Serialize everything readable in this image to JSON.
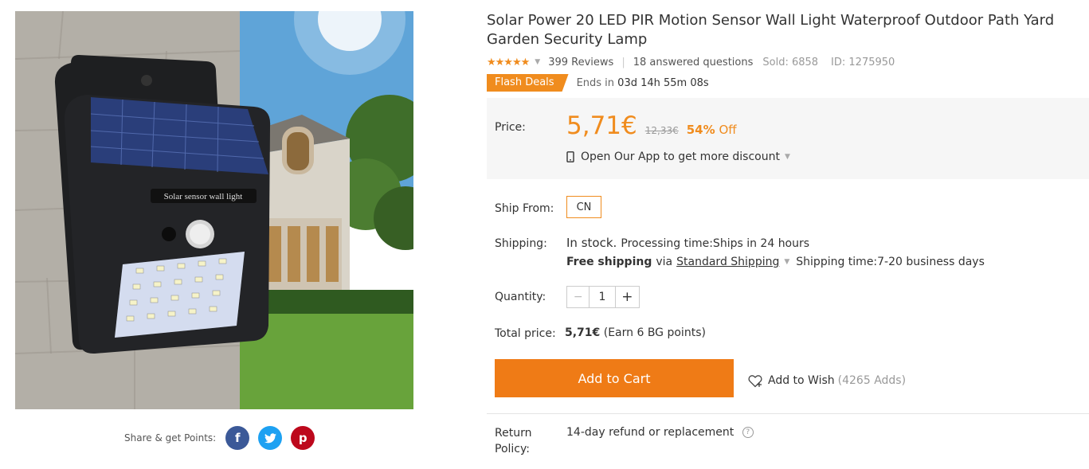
{
  "product": {
    "title": "Solar Power 20 LED PIR Motion Sensor Wall Light Waterproof Outdoor Path Yard Garden Security Lamp",
    "image_lamp_text": "Solar sensor wall light",
    "stars": "★★★★★",
    "rating": 5,
    "reviews": "399 Reviews",
    "answered": "18 answered questions",
    "sold": "Sold: 6858",
    "id": "ID: 1275950"
  },
  "flash": {
    "badge": "Flash Deals",
    "ends_label": "Ends in",
    "ends_time": "03d 14h 55m 08s"
  },
  "price": {
    "label": "Price:",
    "current": "5,71€",
    "old": "12,33€",
    "off_pct": "54%",
    "off_word": "Off",
    "app_text": "Open Our App to get more discount"
  },
  "ship": {
    "from_label": "Ship From:",
    "from_value": "CN",
    "shipping_label": "Shipping:",
    "stock": "In stock.",
    "processing": "Processing time:Ships in 24 hours",
    "free": "Free shipping",
    "via": "via",
    "method": "Standard Shipping",
    "time": "Shipping time:7-20 business days"
  },
  "quantity": {
    "label": "Quantity:",
    "minus": "−",
    "value": "1",
    "plus": "+"
  },
  "total": {
    "label": "Total price:",
    "value": "5,71€",
    "points": "(Earn 6 BG points)"
  },
  "actions": {
    "add_to_cart": "Add to Cart",
    "add_to_wish": "Add to Wish",
    "wish_count": "(4265 Adds)"
  },
  "return": {
    "label_line1": "Return",
    "label_line2": "Policy:",
    "text": "14-day refund or replacement",
    "help": "?"
  },
  "share": {
    "label": "Share & get Points:",
    "facebook": "f",
    "twitter": "t",
    "pinterest": "p"
  },
  "colors": {
    "accent": "#f08c1e",
    "cart_button": "#ef7b16",
    "facebook": "#3b5998",
    "twitter": "#1da1f2",
    "pinterest": "#bd081c"
  }
}
